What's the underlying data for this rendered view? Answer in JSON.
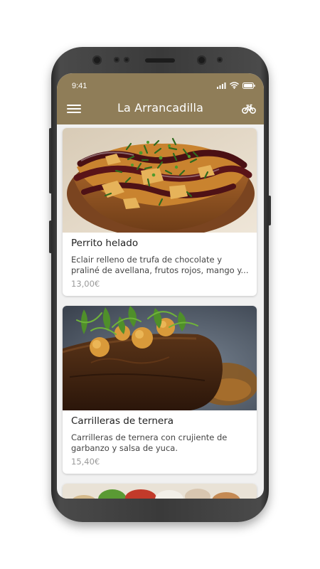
{
  "status_bar": {
    "time": "9:41"
  },
  "app_bar": {
    "title": "La Arrancadilla",
    "menu_icon": "hamburger-menu-icon",
    "action_icon": "bicycle-icon",
    "color": "#8f7d58"
  },
  "dishes": [
    {
      "name": "Perrito helado",
      "description": "Eclair relleno de trufa de chocolate y praliné de avellana, frutos rojos, mango y...",
      "price": "13,00€"
    },
    {
      "name": "Carrilleras de ternera",
      "description": "Carrilleras de ternera con crujiente de garbanzo y salsa de yuca.",
      "price": "15,40€"
    }
  ]
}
